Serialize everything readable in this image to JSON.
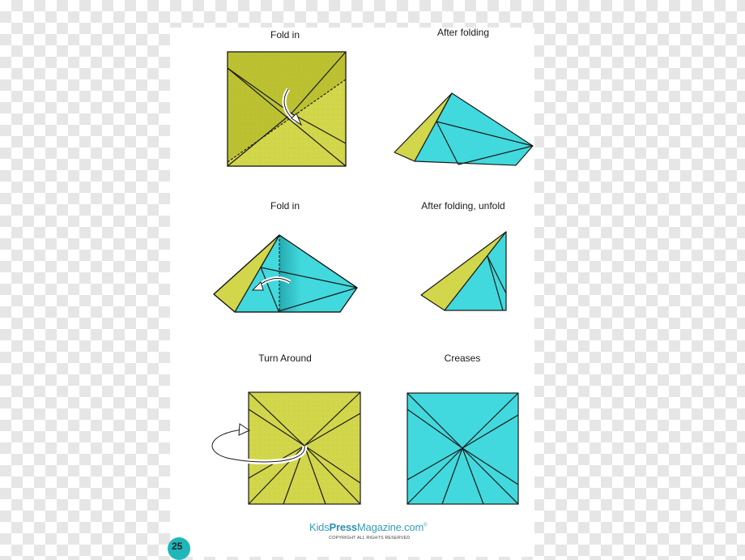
{
  "steps": [
    {
      "label": "Fold in"
    },
    {
      "label": "After folding"
    },
    {
      "label": "Fold in"
    },
    {
      "label": "After folding, unfold"
    },
    {
      "label": "Turn Around"
    },
    {
      "label": "Creases"
    }
  ],
  "brand": {
    "name_part1": "Kids",
    "name_part2": "Press",
    "name_part3": "Magazine",
    "name_part4": ".com",
    "trademark": "®",
    "copyright": "COPYRIGHT ALL RIGHTS RESERVED"
  },
  "page_number": "25",
  "colors": {
    "paper_yellow": "#d2d64a",
    "paper_yellow_shade": "#b9bd2e",
    "paper_cyan": "#41d9dd",
    "paper_cyan_shade": "#25b8bd",
    "outline": "#1a1a1a",
    "page_badge": "#1fb7b9"
  }
}
